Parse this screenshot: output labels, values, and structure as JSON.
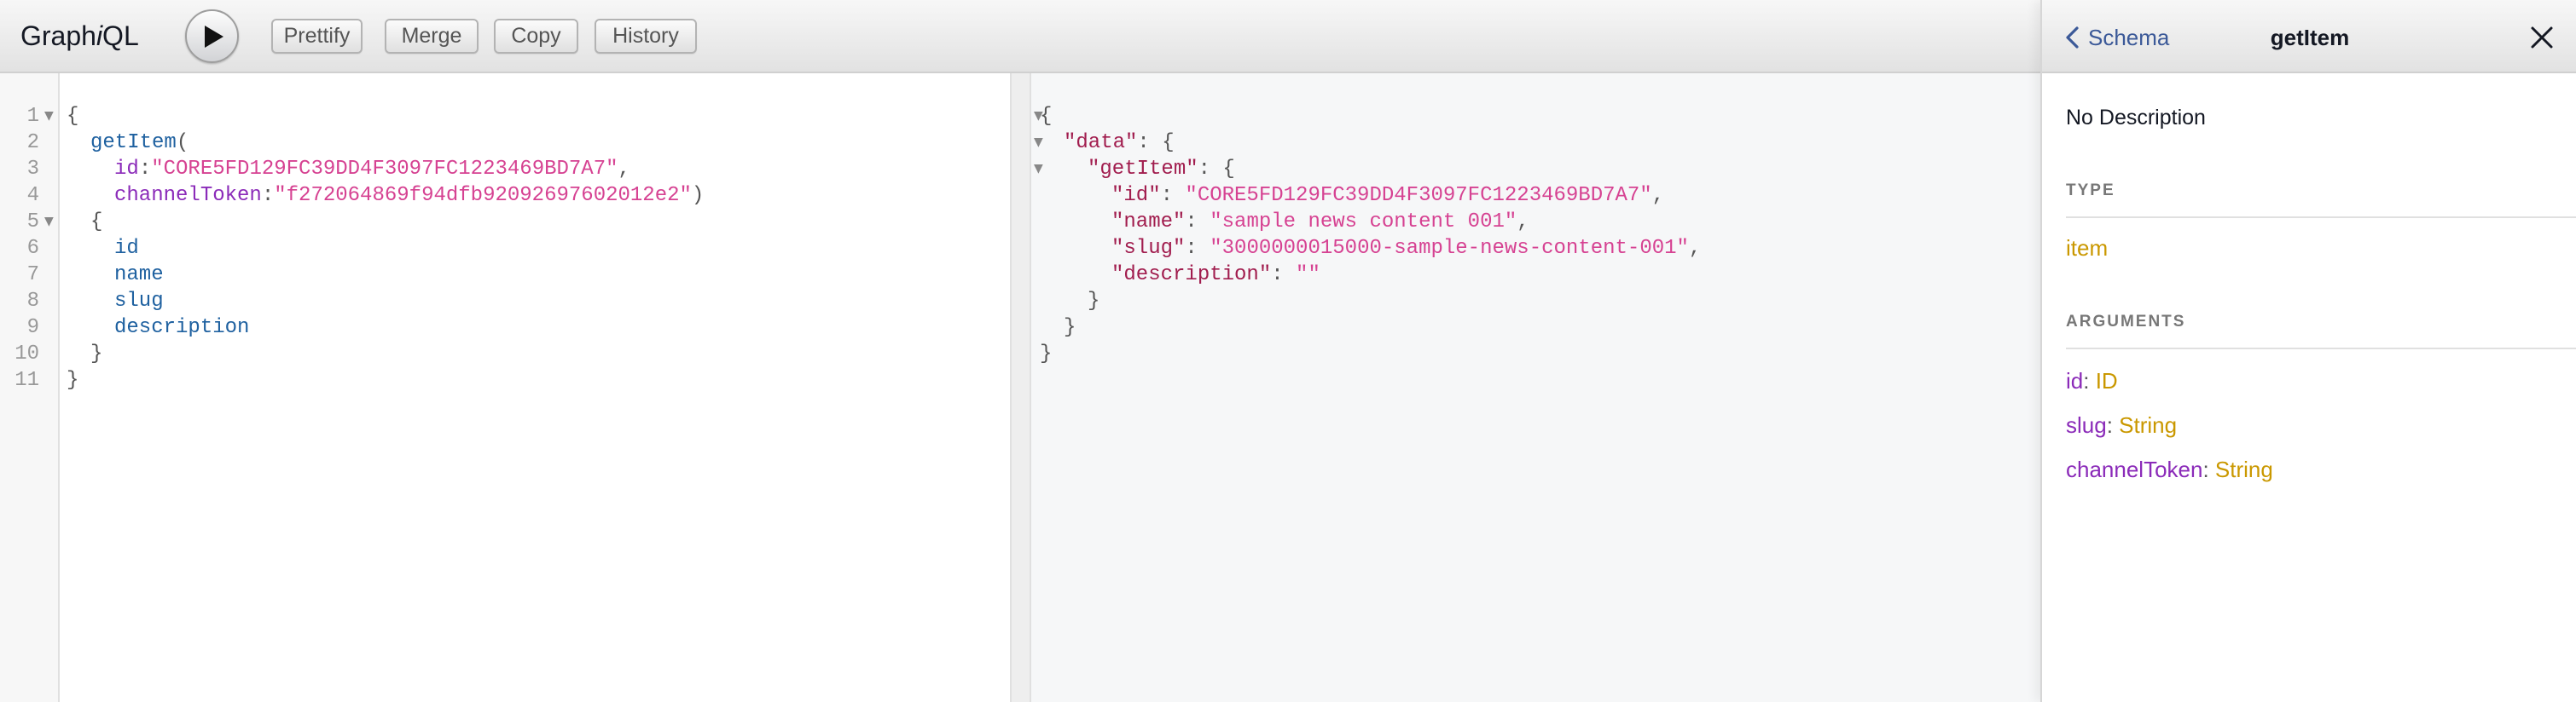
{
  "toolbar": {
    "logo_prefix": "Graph",
    "logo_italic": "i",
    "logo_suffix": "QL",
    "buttons": {
      "prettify": "Prettify",
      "merge": "Merge",
      "copy": "Copy",
      "history": "History"
    }
  },
  "query": {
    "line_numbers": [
      "1",
      "2",
      "3",
      "4",
      "5",
      "6",
      "7",
      "8",
      "9",
      "10",
      "11"
    ],
    "open_brace": "{",
    "op_name": "getItem",
    "open_paren": "(",
    "arg1_name": "id",
    "colon": ":",
    "arg1_value": "\"CORE5FD129FC39DD4F3097FC1223469BD7A7\"",
    "comma": ",",
    "arg2_name": "channelToken",
    "arg2_value": "\"f272064869f94dfb92092697602012e2\"",
    "close_paren": ")",
    "sel_open": "{",
    "fields": [
      "id",
      "name",
      "slug",
      "description"
    ],
    "sel_close": "}",
    "close_brace": "}"
  },
  "result": {
    "open_brace": "{",
    "data_key": "\"data\"",
    "item_key": "\"getItem\"",
    "colon_brace": ": {",
    "rows": [
      {
        "key": "\"id\"",
        "value": "\"CORE5FD129FC39DD4F3097FC1223469BD7A7\"",
        "trail": ","
      },
      {
        "key": "\"name\"",
        "value": "\"sample news content 001\"",
        "trail": ","
      },
      {
        "key": "\"slug\"",
        "value": "\"3000000015000-sample-news-content-001\"",
        "trail": ","
      },
      {
        "key": "\"description\"",
        "value": "\"\"",
        "trail": ""
      }
    ],
    "sep": ": ",
    "close_inner": "}",
    "close_mid": "}",
    "close_outer": "}"
  },
  "docs": {
    "back_label": "Schema",
    "title": "getItem",
    "description": "No Description",
    "type_section": "TYPE",
    "type_name": "item",
    "args_section": "ARGUMENTS",
    "args": [
      {
        "name": "id",
        "type": "ID"
      },
      {
        "name": "slug",
        "type": "String"
      },
      {
        "name": "channelToken",
        "type": "String"
      }
    ],
    "arg_sep": ": "
  },
  "colors": {
    "field": "#1f61a0",
    "attribute": "#8b2bb9",
    "string": "#d64292",
    "property": "#a11d4e",
    "type": "#ca9800",
    "link": "#3b5998"
  },
  "icons": {
    "execute": "play-icon",
    "back": "chevron-left-icon",
    "close": "close-icon",
    "fold": "fold-arrow-icon"
  }
}
